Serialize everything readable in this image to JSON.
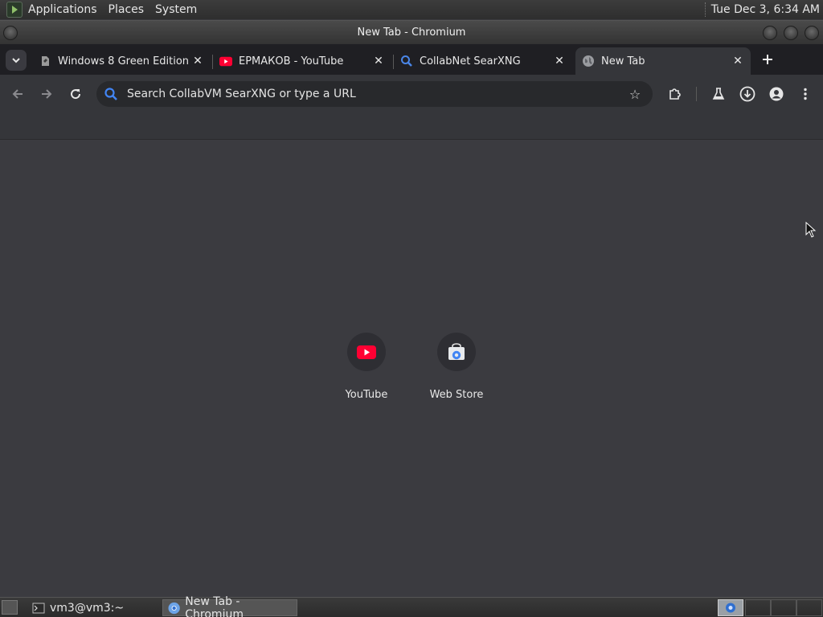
{
  "top_panel": {
    "menus": [
      "Applications",
      "Places",
      "System"
    ],
    "clock": "Tue Dec  3,  6:34 AM"
  },
  "window": {
    "title": "New Tab - Chromium"
  },
  "tabs": [
    {
      "title": "Windows 8 Green Edition",
      "icon": "file-icon"
    },
    {
      "title": "ЕРМАКОВ - YouTube",
      "icon": "youtube-icon"
    },
    {
      "title": "CollabNet SearXNG",
      "icon": "search-icon"
    },
    {
      "title": "New Tab",
      "icon": "globe-icon",
      "active": true
    }
  ],
  "toolbar": {
    "omnibox_placeholder": "Search CollabVM SearXNG or type a URL"
  },
  "shortcuts": [
    {
      "label": "YouTube",
      "icon": "youtube-icon"
    },
    {
      "label": "Web Store",
      "icon": "webstore-icon"
    }
  ],
  "taskbar": {
    "items": [
      {
        "label": "vm3@vm3:~",
        "icon": "terminal-icon"
      },
      {
        "label": "New Tab - Chromium",
        "icon": "chromium-icon",
        "active": true
      }
    ]
  },
  "colors": {
    "youtube_red": "#ff0033",
    "search_blue": "#4285f4"
  }
}
